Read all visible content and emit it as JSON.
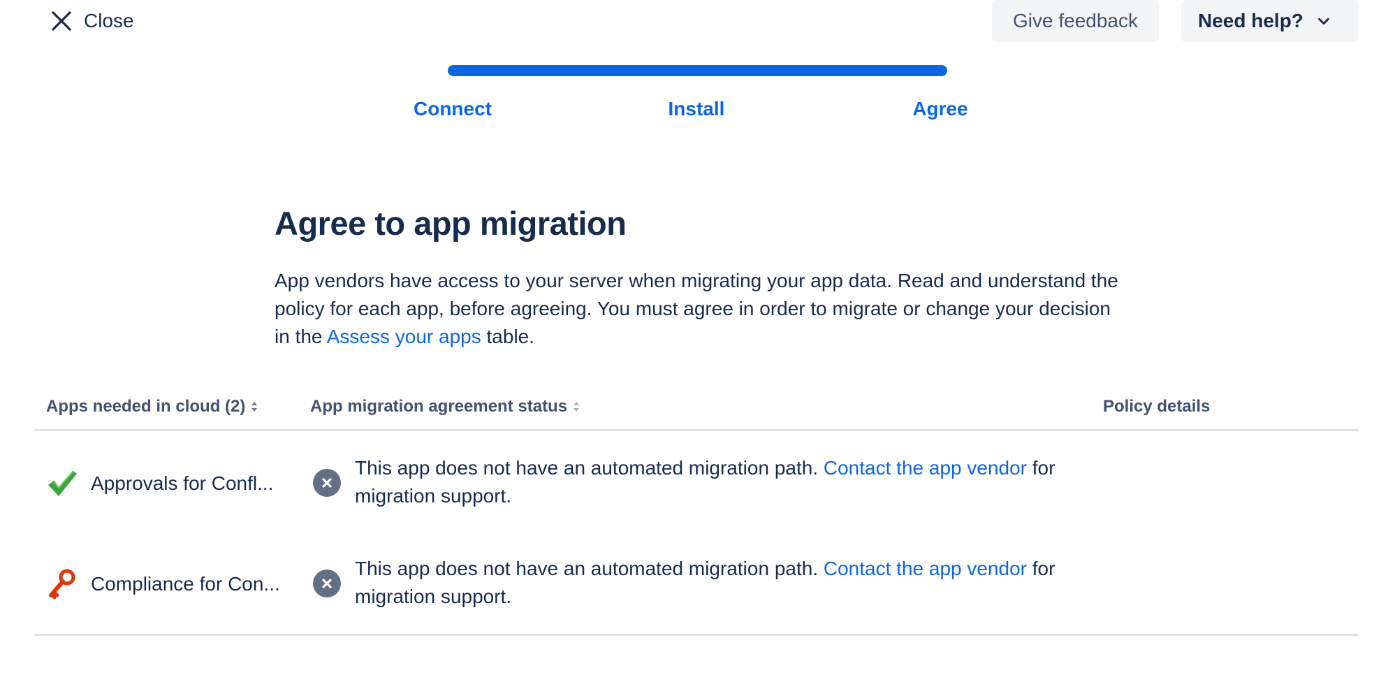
{
  "topbar": {
    "close_label": "Close",
    "feedback_label": "Give feedback",
    "help_label": "Need help?"
  },
  "progress": {
    "value": 1.0,
    "steps": [
      "Connect",
      "Install",
      "Agree"
    ]
  },
  "page": {
    "title": "Agree to app migration",
    "description_before": "App vendors have access to your server when migrating your app data. Read and understand the policy for each app, before agreeing. You must agree in order to migrate or change your decision in the ",
    "description_link": "Assess your apps",
    "description_after": " table."
  },
  "table": {
    "headers": {
      "apps": "Apps needed in cloud (2)",
      "status": "App migration agreement status",
      "policy": "Policy details"
    },
    "rows": [
      {
        "app_name": "Approvals for Confl...",
        "app_icon": "checkmark-icon",
        "status_icon": "x-circle-icon",
        "status_text_before": "This app does not have an automated migration path. ",
        "status_link": "Contact the app vendor",
        "status_text_after": " for migration support."
      },
      {
        "app_name": "Compliance for Con...",
        "app_icon": "key-icon",
        "status_icon": "x-circle-icon",
        "status_text_before": "This app does not have an automated migration path. ",
        "status_link": "Contact the app vendor",
        "status_text_after": " for migration support."
      }
    ]
  },
  "colors": {
    "accent": "#0c66e4",
    "text": "#172b4d",
    "subtle_text": "#42526e",
    "button_bg": "#f4f5f7",
    "status_icon_bg": "#626f86",
    "check_green": "#3aa63f",
    "key_red": "#de350b"
  }
}
